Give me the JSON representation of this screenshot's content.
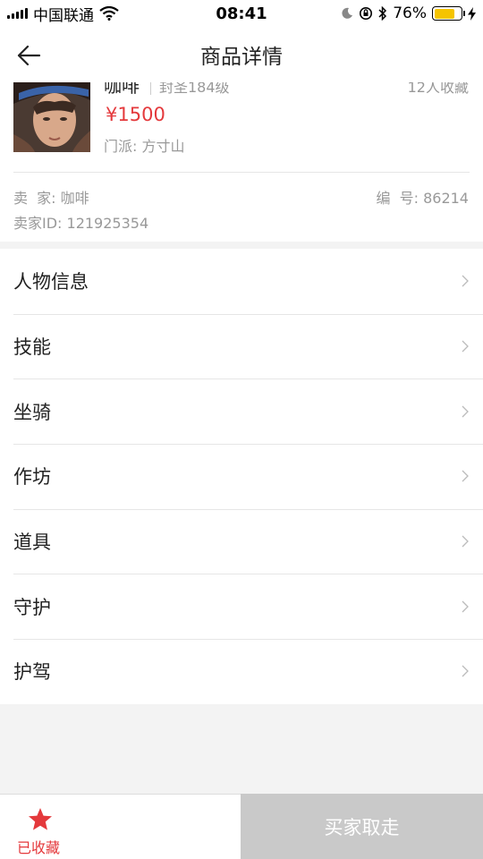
{
  "status_bar": {
    "carrier": "中国联通",
    "time": "08:41",
    "battery_percent": "76%",
    "battery_level": 0.76,
    "battery_color": "#f5c400",
    "icons": [
      "signal-icon",
      "wifi-icon",
      "moon-icon",
      "rotation-lock-icon",
      "bluetooth-icon",
      "battery-icon",
      "charging-icon"
    ]
  },
  "nav": {
    "title": "商品详情",
    "back_icon": "back-arrow-icon"
  },
  "product": {
    "seller_name": "咖啡",
    "level": "封圣184级",
    "favorites": "12人收藏",
    "price": "¥1500",
    "school": "门派: 方寸山",
    "seller": "卖  家: 咖啡",
    "item_no": "编  号: 86214",
    "seller_id": "卖家ID: 121925354"
  },
  "menu": {
    "items": [
      {
        "label": "人物信息"
      },
      {
        "label": "技能"
      },
      {
        "label": "坐骑"
      },
      {
        "label": "作坊"
      },
      {
        "label": "道具"
      },
      {
        "label": "守护"
      },
      {
        "label": "护驾"
      }
    ],
    "chevron_icon": "chevron-right-icon"
  },
  "bottom_bar": {
    "favorite_label": "已收藏",
    "favorite_icon": "star-icon",
    "buy_label": "买家取走"
  },
  "colors": {
    "accent_red": "#e4393c",
    "disabled_gray": "#c9c9c9"
  }
}
